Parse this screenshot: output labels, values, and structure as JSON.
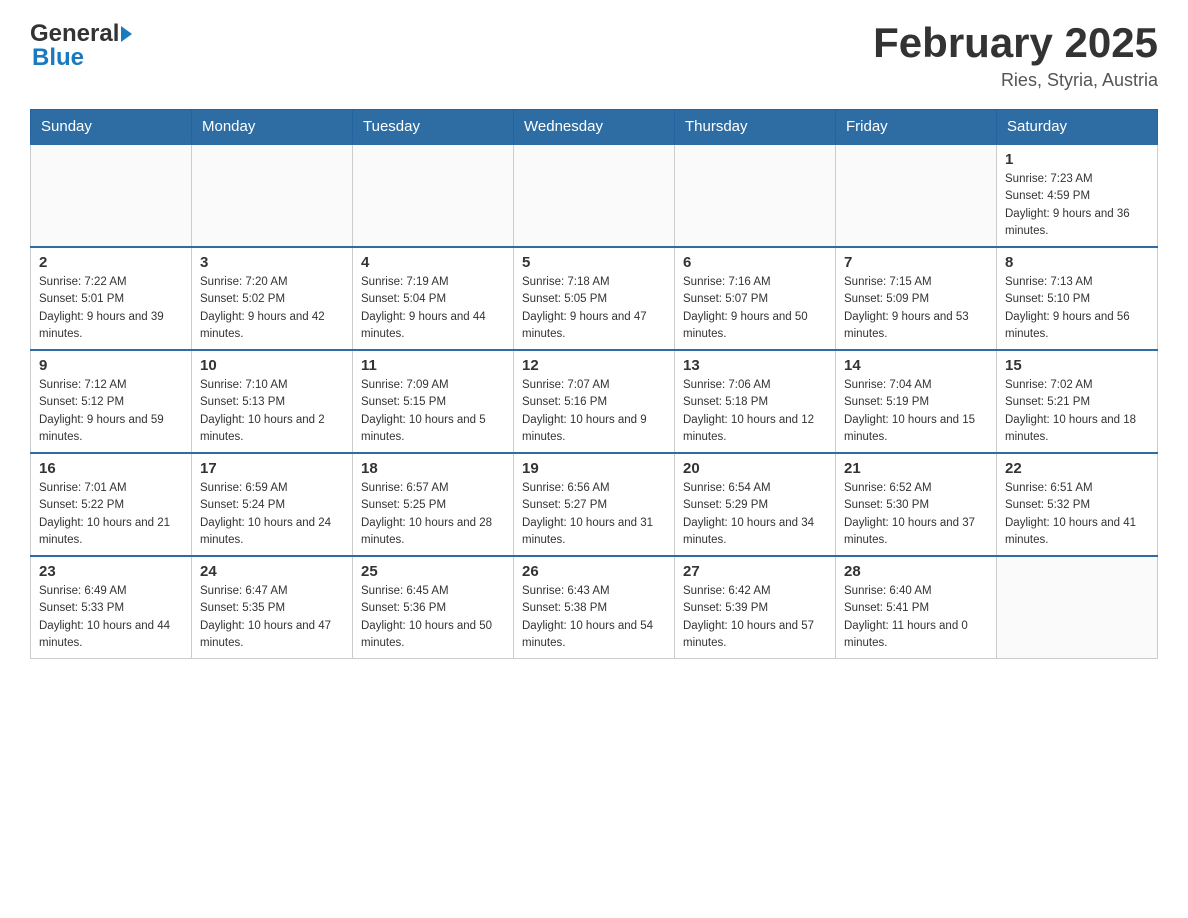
{
  "header": {
    "logo_general": "General",
    "logo_blue": "Blue",
    "title": "February 2025",
    "subtitle": "Ries, Styria, Austria"
  },
  "weekdays": [
    "Sunday",
    "Monday",
    "Tuesday",
    "Wednesday",
    "Thursday",
    "Friday",
    "Saturday"
  ],
  "weeks": [
    {
      "days": [
        {
          "num": "",
          "info": ""
        },
        {
          "num": "",
          "info": ""
        },
        {
          "num": "",
          "info": ""
        },
        {
          "num": "",
          "info": ""
        },
        {
          "num": "",
          "info": ""
        },
        {
          "num": "",
          "info": ""
        },
        {
          "num": "1",
          "info": "Sunrise: 7:23 AM\nSunset: 4:59 PM\nDaylight: 9 hours and 36 minutes."
        }
      ]
    },
    {
      "days": [
        {
          "num": "2",
          "info": "Sunrise: 7:22 AM\nSunset: 5:01 PM\nDaylight: 9 hours and 39 minutes."
        },
        {
          "num": "3",
          "info": "Sunrise: 7:20 AM\nSunset: 5:02 PM\nDaylight: 9 hours and 42 minutes."
        },
        {
          "num": "4",
          "info": "Sunrise: 7:19 AM\nSunset: 5:04 PM\nDaylight: 9 hours and 44 minutes."
        },
        {
          "num": "5",
          "info": "Sunrise: 7:18 AM\nSunset: 5:05 PM\nDaylight: 9 hours and 47 minutes."
        },
        {
          "num": "6",
          "info": "Sunrise: 7:16 AM\nSunset: 5:07 PM\nDaylight: 9 hours and 50 minutes."
        },
        {
          "num": "7",
          "info": "Sunrise: 7:15 AM\nSunset: 5:09 PM\nDaylight: 9 hours and 53 minutes."
        },
        {
          "num": "8",
          "info": "Sunrise: 7:13 AM\nSunset: 5:10 PM\nDaylight: 9 hours and 56 minutes."
        }
      ]
    },
    {
      "days": [
        {
          "num": "9",
          "info": "Sunrise: 7:12 AM\nSunset: 5:12 PM\nDaylight: 9 hours and 59 minutes."
        },
        {
          "num": "10",
          "info": "Sunrise: 7:10 AM\nSunset: 5:13 PM\nDaylight: 10 hours and 2 minutes."
        },
        {
          "num": "11",
          "info": "Sunrise: 7:09 AM\nSunset: 5:15 PM\nDaylight: 10 hours and 5 minutes."
        },
        {
          "num": "12",
          "info": "Sunrise: 7:07 AM\nSunset: 5:16 PM\nDaylight: 10 hours and 9 minutes."
        },
        {
          "num": "13",
          "info": "Sunrise: 7:06 AM\nSunset: 5:18 PM\nDaylight: 10 hours and 12 minutes."
        },
        {
          "num": "14",
          "info": "Sunrise: 7:04 AM\nSunset: 5:19 PM\nDaylight: 10 hours and 15 minutes."
        },
        {
          "num": "15",
          "info": "Sunrise: 7:02 AM\nSunset: 5:21 PM\nDaylight: 10 hours and 18 minutes."
        }
      ]
    },
    {
      "days": [
        {
          "num": "16",
          "info": "Sunrise: 7:01 AM\nSunset: 5:22 PM\nDaylight: 10 hours and 21 minutes."
        },
        {
          "num": "17",
          "info": "Sunrise: 6:59 AM\nSunset: 5:24 PM\nDaylight: 10 hours and 24 minutes."
        },
        {
          "num": "18",
          "info": "Sunrise: 6:57 AM\nSunset: 5:25 PM\nDaylight: 10 hours and 28 minutes."
        },
        {
          "num": "19",
          "info": "Sunrise: 6:56 AM\nSunset: 5:27 PM\nDaylight: 10 hours and 31 minutes."
        },
        {
          "num": "20",
          "info": "Sunrise: 6:54 AM\nSunset: 5:29 PM\nDaylight: 10 hours and 34 minutes."
        },
        {
          "num": "21",
          "info": "Sunrise: 6:52 AM\nSunset: 5:30 PM\nDaylight: 10 hours and 37 minutes."
        },
        {
          "num": "22",
          "info": "Sunrise: 6:51 AM\nSunset: 5:32 PM\nDaylight: 10 hours and 41 minutes."
        }
      ]
    },
    {
      "days": [
        {
          "num": "23",
          "info": "Sunrise: 6:49 AM\nSunset: 5:33 PM\nDaylight: 10 hours and 44 minutes."
        },
        {
          "num": "24",
          "info": "Sunrise: 6:47 AM\nSunset: 5:35 PM\nDaylight: 10 hours and 47 minutes."
        },
        {
          "num": "25",
          "info": "Sunrise: 6:45 AM\nSunset: 5:36 PM\nDaylight: 10 hours and 50 minutes."
        },
        {
          "num": "26",
          "info": "Sunrise: 6:43 AM\nSunset: 5:38 PM\nDaylight: 10 hours and 54 minutes."
        },
        {
          "num": "27",
          "info": "Sunrise: 6:42 AM\nSunset: 5:39 PM\nDaylight: 10 hours and 57 minutes."
        },
        {
          "num": "28",
          "info": "Sunrise: 6:40 AM\nSunset: 5:41 PM\nDaylight: 11 hours and 0 minutes."
        },
        {
          "num": "",
          "info": ""
        }
      ]
    }
  ]
}
